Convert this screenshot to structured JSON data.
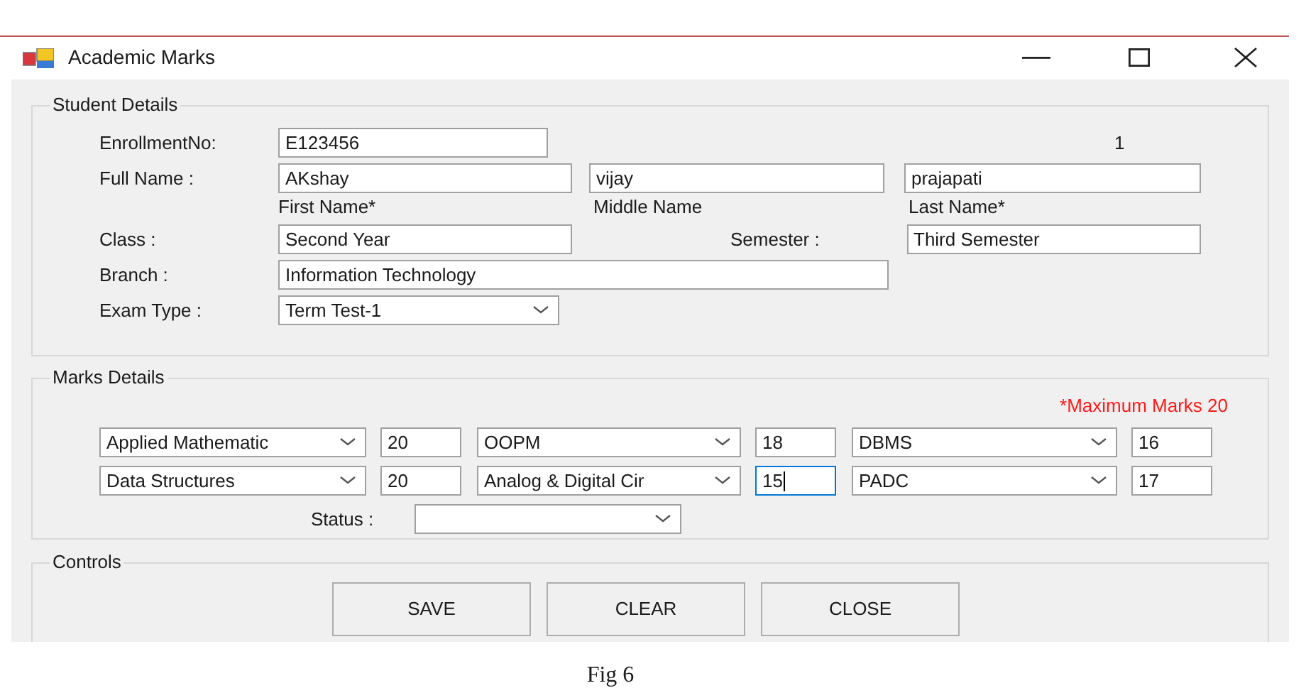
{
  "window": {
    "title": "Academic Marks"
  },
  "student_details": {
    "title": "Student Details",
    "enrollment_label": "EnrollmentNo:",
    "enrollment_value": "E123456",
    "record_number": "1",
    "full_name_label": "Full Name :",
    "first_name": "AKshay",
    "middle_name": "vijay",
    "last_name": "prajapati",
    "first_name_caption": "First Name*",
    "middle_name_caption": "Middle Name",
    "last_name_caption": "Last Name*",
    "class_label": "Class :",
    "class_value": "Second Year",
    "semester_label": "Semester :",
    "semester_value": "Third Semester",
    "branch_label": "Branch :",
    "branch_value": "Information Technology",
    "exam_type_label": "Exam Type :",
    "exam_type_value": "Term Test-1"
  },
  "marks_details": {
    "title": "Marks Details",
    "note": "*Maximum Marks 20",
    "rows": [
      [
        {
          "subject": "Applied Mathematic",
          "marks": "20",
          "focused": false
        },
        {
          "subject": "OOPM",
          "marks": "18",
          "focused": false
        },
        {
          "subject": "DBMS",
          "marks": "16",
          "focused": false
        }
      ],
      [
        {
          "subject": "Data Structures",
          "marks": "20",
          "focused": false
        },
        {
          "subject": "Analog & Digital Cir",
          "marks": "15",
          "focused": true
        },
        {
          "subject": "PADC",
          "marks": "17",
          "focused": false
        }
      ]
    ],
    "status_label": "Status :"
  },
  "controls": {
    "title": "Controls",
    "buttons": [
      "SAVE",
      "CLEAR",
      "CLOSE"
    ]
  },
  "caption": "Fig 6"
}
